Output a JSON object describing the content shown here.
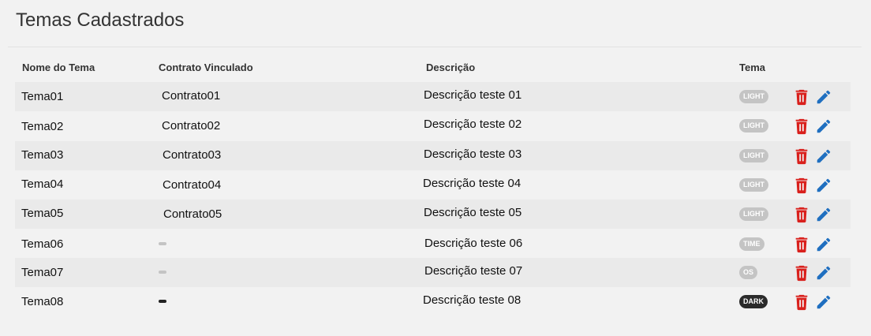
{
  "page": {
    "title": "Temas Cadastrados"
  },
  "table": {
    "headers": {
      "name": "Nome do Tema",
      "contract": "Contrato Vinculado",
      "description": "Descrição",
      "theme": "Tema"
    },
    "rows": [
      {
        "name": "Tema01",
        "contract": "Contrato01",
        "description": "Descrição teste 01",
        "theme": "LIGHT"
      },
      {
        "name": "Tema02",
        "contract": "Contrato02",
        "description": "Descrição teste 02",
        "theme": "LIGHT"
      },
      {
        "name": "Tema03",
        "contract": "Contrato03",
        "description": "Descrição teste 03",
        "theme": "LIGHT"
      },
      {
        "name": "Tema04",
        "contract": "Contrato04",
        "description": "Descrição teste 04",
        "theme": "LIGHT"
      },
      {
        "name": "Tema05",
        "contract": "Contrato05",
        "description": "Descrição teste 05",
        "theme": "LIGHT"
      },
      {
        "name": "Tema06",
        "contract": "",
        "description": "Descrição teste 06",
        "theme": "TIME"
      },
      {
        "name": "Tema07",
        "contract": "",
        "description": "Descrição teste 07",
        "theme": "OS"
      },
      {
        "name": "Tema08",
        "contract": "",
        "description": "Descrição teste 08",
        "theme": "DARK"
      }
    ]
  },
  "icons": {
    "delete": "trash-icon",
    "edit": "pencil-icon"
  },
  "colors": {
    "badge_default": "#c4c4c4",
    "badge_dark": "#2b2b2b",
    "delete": "#d9201c",
    "edit": "#1f6fc0",
    "dash_default": "#c4c4c4",
    "dash_dark": "#222222"
  }
}
